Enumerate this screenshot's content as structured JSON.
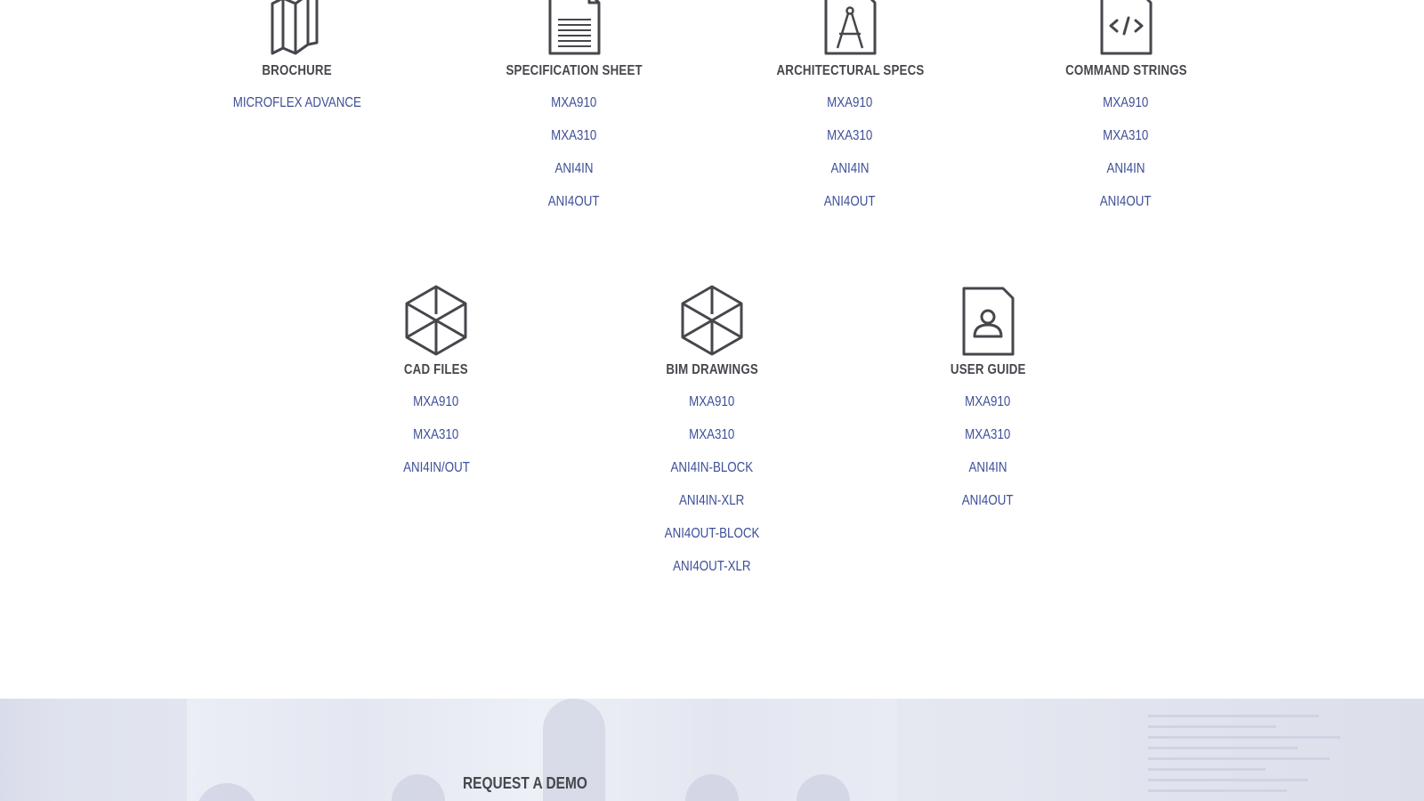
{
  "sections": [
    {
      "title": "BROCHURE",
      "icon": "folded-brochure-icon",
      "links": [
        "MICROFLEX ADVANCE"
      ]
    },
    {
      "title": "SPECIFICATION SHEET",
      "icon": "document-lines-icon",
      "links": [
        "MXA910",
        "MXA310",
        "ANI4IN",
        "ANI4OUT"
      ]
    },
    {
      "title": "ARCHITECTURAL SPECS",
      "icon": "drafting-compass-document-icon",
      "links": [
        "MXA910",
        "MXA310",
        "ANI4IN",
        "ANI4OUT"
      ]
    },
    {
      "title": "COMMAND STRINGS",
      "icon": "code-document-icon",
      "links": [
        "MXA910",
        "MXA310",
        "ANI4IN",
        "ANI4OUT"
      ]
    },
    {
      "title": "CAD FILES",
      "icon": "3d-cube-icon",
      "links": [
        "MXA910",
        "MXA310",
        "ANI4IN/OUT"
      ]
    },
    {
      "title": "BIM DRAWINGS",
      "icon": "3d-cube-icon",
      "links": [
        "MXA910",
        "MXA310",
        "ANI4IN-BLOCK",
        "ANI4IN-XLR",
        "ANI4OUT-BLOCK",
        "ANI4OUT-XLR"
      ]
    },
    {
      "title": "USER GUIDE",
      "icon": "user-document-icon",
      "links": [
        "MXA910",
        "MXA310",
        "ANI4IN",
        "ANI4OUT"
      ]
    }
  ],
  "banner": {
    "title": "REQUEST A DEMO"
  },
  "colors": {
    "link": "#3d4f99",
    "heading": "#46474d",
    "icon_stroke": "#46474d",
    "banner_bg": "#e8eaf3"
  }
}
